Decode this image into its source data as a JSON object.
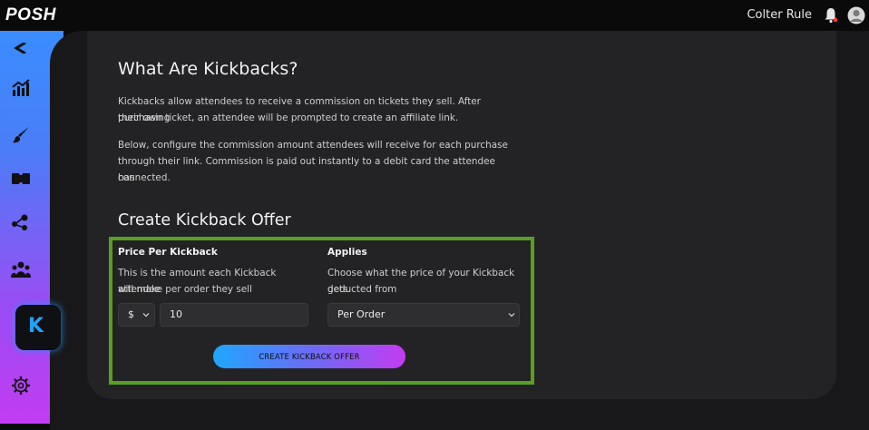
{
  "header": {
    "logo": "POSH",
    "user_name": "Colter Rule"
  },
  "sidebar": {
    "items": [
      {
        "icon": "analytics-icon"
      },
      {
        "icon": "brush-icon"
      },
      {
        "icon": "ticket-icon"
      },
      {
        "icon": "affiliate-icon"
      },
      {
        "icon": "team-icon"
      },
      {
        "icon": "kickback-icon",
        "label": "K"
      },
      {
        "icon": "gear-icon"
      }
    ]
  },
  "main": {
    "title": "What Are Kickbacks?",
    "paragraph1_line1": "Kickbacks allow attendees to receive a commission on tickets they sell. After purchasing",
    "paragraph1_line2": "their own ticket, an attendee will be prompted to create an affiliate link.",
    "paragraph2_line1": "Below, configure the commission amount attendees will receive for each purchase",
    "paragraph2_line2": "through their link. Commission is paid out instantly to a debit card the attendee has",
    "paragraph2_line3": "connected.",
    "create_title": "Create Kickback Offer",
    "price_heading": "Price Per Kickback",
    "price_desc_line1": "This is the amount each Kickback attendee",
    "price_desc_line2": "will make per order they sell",
    "currency_value": "$",
    "amount_value": "10",
    "applies_heading": "Applies",
    "applies_desc_line1": "Choose what the price of your Kickback gets",
    "applies_desc_line2": "deducted from",
    "applies_value": "Per Order",
    "cta_label": "CREATE KICKBACK OFFER"
  },
  "colors": {
    "highlight_border": "#57a021",
    "kickback_accent": "#21a3ff"
  }
}
